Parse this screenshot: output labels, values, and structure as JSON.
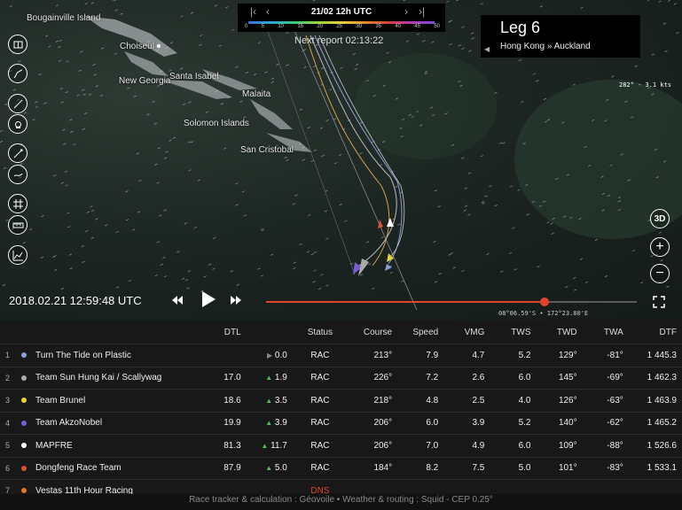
{
  "topbar": {
    "timestamp": "21/02 12h UTC",
    "scale": [
      "0",
      "5",
      "10",
      "15",
      "20",
      "25",
      "30",
      "35",
      "40",
      "45",
      "50"
    ],
    "next_report": "Next report 02:13:22"
  },
  "leg": {
    "title": "Leg 6",
    "route": "Hong Kong » Auckland"
  },
  "wind_readout": "282° - 3.1 kts",
  "places": [
    {
      "name": "Bougainville Island"
    },
    {
      "name": "Choiseul"
    },
    {
      "name": "New Georgia"
    },
    {
      "name": "Santa Isabel"
    },
    {
      "name": "Malaita"
    },
    {
      "name": "Solomon Islands"
    },
    {
      "name": "San Cristobal"
    }
  ],
  "map_controls": {
    "three_d": "3D"
  },
  "playback": {
    "datetime": "2018.02.21 12:59:48 UTC",
    "progress": 0.75
  },
  "coords": "08°06.59'S • 172°23.80'E",
  "table": {
    "headers": [
      "DTL",
      "Status",
      "Course",
      "Speed",
      "VMG",
      "TWS",
      "TWD",
      "TWA",
      "DTF"
    ],
    "rows": [
      {
        "rank": "1",
        "team": "Turn The Tide on Plastic",
        "color": "#8a9fd8",
        "dtl": "",
        "trend": "▶",
        "gain": "0.0",
        "status": "RAC",
        "course": "213°",
        "speed": "7.9",
        "vmg": "4.7",
        "tws": "5.2",
        "twd": "129°",
        "twa": "-81°",
        "dtf": "1 445.3"
      },
      {
        "rank": "2",
        "team": "Team Sun Hung Kai / Scallywag",
        "color": "#aaaaaa",
        "dtl": "17.0",
        "trend": "▲",
        "gain": "1.9",
        "status": "RAC",
        "course": "226°",
        "speed": "7.2",
        "vmg": "2.6",
        "tws": "6.0",
        "twd": "145°",
        "twa": "-69°",
        "dtf": "1 462.3"
      },
      {
        "rank": "3",
        "team": "Team Brunel",
        "color": "#e6d23a",
        "dtl": "18.6",
        "trend": "▲",
        "gain": "3.5",
        "status": "RAC",
        "course": "218°",
        "speed": "4.8",
        "vmg": "2.5",
        "tws": "4.0",
        "twd": "126°",
        "twa": "-63°",
        "dtf": "1 463.9"
      },
      {
        "rank": "4",
        "team": "Team AkzoNobel",
        "color": "#7a5cd6",
        "dtl": "19.9",
        "trend": "▲",
        "gain": "3.9",
        "status": "RAC",
        "course": "206°",
        "speed": "6.0",
        "vmg": "3.9",
        "tws": "5.2",
        "twd": "140°",
        "twa": "-62°",
        "dtf": "1 465.2"
      },
      {
        "rank": "5",
        "team": "MAPFRE",
        "color": "#ffffff",
        "dtl": "81.3",
        "trend": "▲",
        "gain": "11.7",
        "status": "RAC",
        "course": "206°",
        "speed": "7.0",
        "vmg": "4.9",
        "tws": "6.0",
        "twd": "109°",
        "twa": "-88°",
        "dtf": "1 526.6"
      },
      {
        "rank": "6",
        "team": "Dongfeng Race Team",
        "color": "#d8523a",
        "dtl": "87.9",
        "trend": "▲",
        "gain": "5.0",
        "status": "RAC",
        "course": "184°",
        "speed": "8.2",
        "vmg": "7.5",
        "tws": "5.0",
        "twd": "101°",
        "twa": "-83°",
        "dtf": "1 533.1"
      },
      {
        "rank": "7",
        "team": "Vestas 11th Hour Racing",
        "color": "#e07a2a",
        "dtl": "",
        "trend": "",
        "gain": "",
        "status": "DNS",
        "course": "",
        "speed": "",
        "vmg": "",
        "tws": "",
        "twd": "",
        "twa": "",
        "dtf": ""
      }
    ]
  },
  "footer": "Race tracker & calculation : Géovoile • Weather & routing : Squid - CEP 0.25°"
}
